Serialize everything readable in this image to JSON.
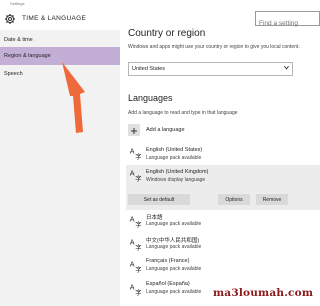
{
  "window": {
    "title": "Settings"
  },
  "header": {
    "title": "TIME & LANGUAGE",
    "gear_icon": "gear-icon"
  },
  "search": {
    "placeholder": "Find a setting"
  },
  "sidebar": {
    "items": [
      {
        "label": "Date & time"
      },
      {
        "label": "Region & language",
        "active": true
      },
      {
        "label": "Speech"
      }
    ]
  },
  "country": {
    "heading": "Country or region",
    "description": "Windows and apps might use your country or region to give you local content.",
    "selected": "United States"
  },
  "languages": {
    "heading": "Languages",
    "description": "Add a language to read and type in that language",
    "add_label": "Add a language",
    "items": [
      {
        "name": "English (United States)",
        "status": "Language pack available"
      },
      {
        "name": "English (United Kingdom)",
        "status": "Windows display language"
      },
      {
        "name": "日本語",
        "status": "Language pack available"
      },
      {
        "name": "中文(中华人民共和国)",
        "status": "Language pack available"
      },
      {
        "name": "Français (France)",
        "status": "Language pack available"
      },
      {
        "name": "Español (España)",
        "status": "Language pack available"
      }
    ],
    "buttons": {
      "set_default": "Set as default",
      "options": "Options",
      "remove": "Remove"
    }
  },
  "colors": {
    "accent_sidebar": "#c3aed6",
    "arrow": "#ef6a3a",
    "watermark": "#8b1a1a"
  },
  "watermark": "ma3loumah.com"
}
